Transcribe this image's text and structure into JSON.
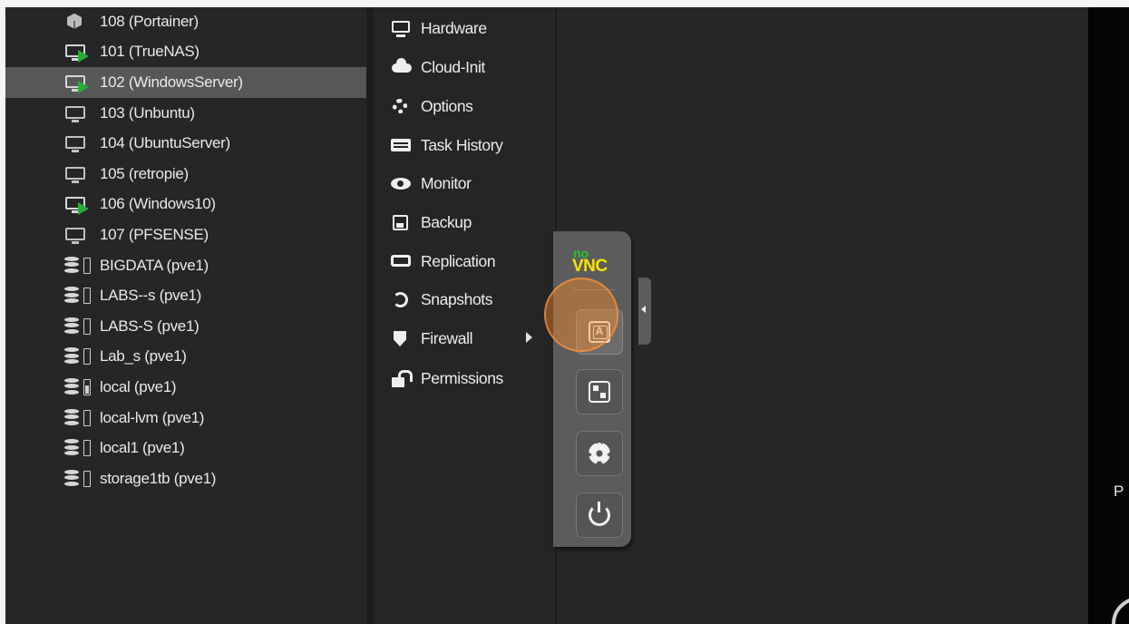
{
  "tree": {
    "items": [
      {
        "label": "108 (Portainer)",
        "icon": "container-icon",
        "selected": false
      },
      {
        "label": "101 (TrueNAS)",
        "icon": "vm-running-icon",
        "selected": false
      },
      {
        "label": "102 (WindowsServer)",
        "icon": "vm-running-icon",
        "selected": true
      },
      {
        "label": "103 (Unbuntu)",
        "icon": "vm-stopped-icon",
        "selected": false
      },
      {
        "label": "104 (UbuntuServer)",
        "icon": "vm-stopped-icon",
        "selected": false
      },
      {
        "label": "105 (retropie)",
        "icon": "vm-stopped-icon",
        "selected": false
      },
      {
        "label": "106 (Windows10)",
        "icon": "vm-running-icon",
        "selected": false
      },
      {
        "label": "107 (PFSENSE)",
        "icon": "vm-stopped-icon",
        "selected": false
      },
      {
        "label": "BIGDATA (pve1)",
        "icon": "storage-icon",
        "selected": false
      },
      {
        "label": "LABS--s (pve1)",
        "icon": "storage-icon",
        "selected": false
      },
      {
        "label": "LABS-S (pve1)",
        "icon": "storage-icon",
        "selected": false
      },
      {
        "label": "Lab_s (pve1)",
        "icon": "storage-icon",
        "selected": false
      },
      {
        "label": "local (pve1)",
        "icon": "storage-icon",
        "selected": false
      },
      {
        "label": "local-lvm (pve1)",
        "icon": "storage-icon",
        "selected": false
      },
      {
        "label": "local1 (pve1)",
        "icon": "storage-icon",
        "selected": false
      },
      {
        "label": "storage1tb (pve1)",
        "icon": "storage-icon",
        "selected": false
      }
    ]
  },
  "menu": {
    "items": [
      {
        "label": "Hardware",
        "icon": "monitor-icon"
      },
      {
        "label": "Cloud-Init",
        "icon": "cloud-icon"
      },
      {
        "label": "Options",
        "icon": "gear-icon"
      },
      {
        "label": "Task History",
        "icon": "list-icon"
      },
      {
        "label": "Monitor",
        "icon": "eye-icon"
      },
      {
        "label": "Backup",
        "icon": "floppy-icon"
      },
      {
        "label": "Replication",
        "icon": "retweet-icon"
      },
      {
        "label": "Snapshots",
        "icon": "history-icon"
      },
      {
        "label": "Firewall",
        "icon": "shield-icon",
        "has_submenu": true
      },
      {
        "label": "Permissions",
        "icon": "unlock-icon"
      }
    ]
  },
  "novnc": {
    "logo_top": "no",
    "logo_bottom": "VNC",
    "buttons": [
      {
        "name": "extra-keys",
        "icon": "keyboard-icon",
        "active": true
      },
      {
        "name": "clipboard",
        "icon": "clipboard-icon",
        "active": false
      },
      {
        "name": "settings",
        "icon": "gear-icon",
        "active": false
      },
      {
        "name": "power",
        "icon": "power-icon",
        "active": false
      }
    ],
    "handle_icon": "caret-left-icon",
    "colors": {
      "logo_no": "#27c22b",
      "logo_vnc": "#f5e500",
      "bar": "#5c5c5c"
    }
  },
  "console": {
    "fragment": "P"
  },
  "colors": {
    "running_indicator": "#2ea83a",
    "selected_row": "#575757",
    "panel_bg": "#262626",
    "cursor_highlight": "#ff8c28"
  }
}
